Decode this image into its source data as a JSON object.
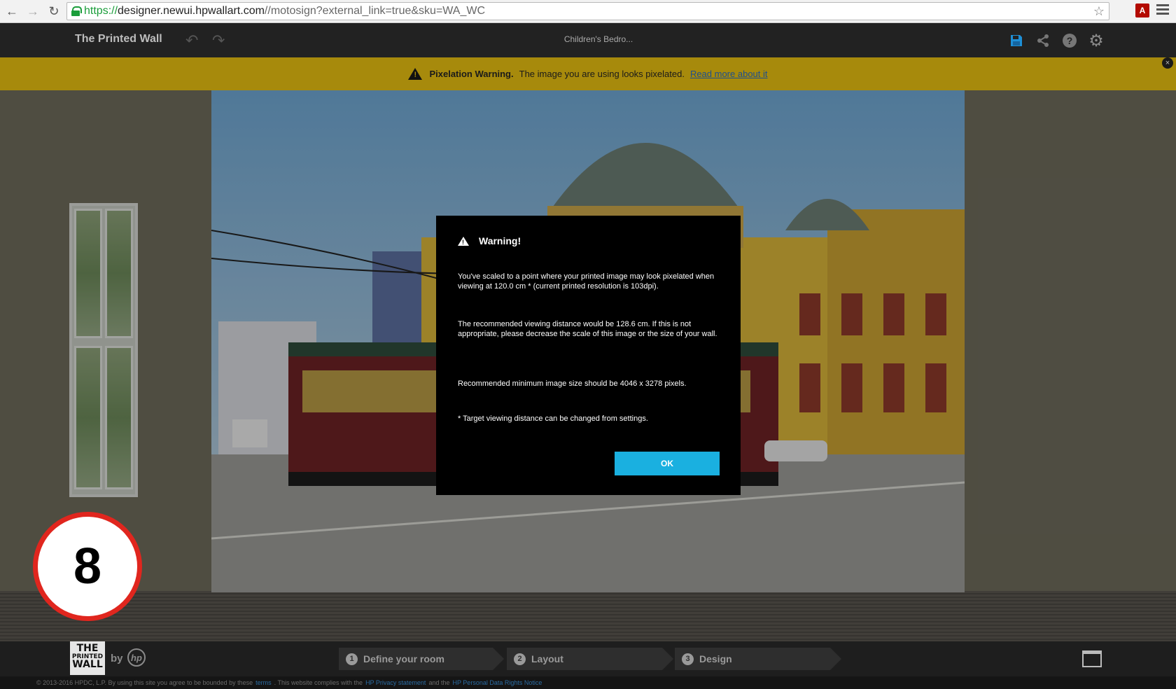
{
  "browser": {
    "url_scheme": "https://",
    "url_host": "designer.newui.hpwallart.com",
    "url_path": "//motosign?external_link=true&sku=WA_WC",
    "pdf_label": "A"
  },
  "app": {
    "brand": "The Printed Wall",
    "document_title": "Children's Bedro..."
  },
  "pixelation_bar": {
    "title": "Pixelation Warning.",
    "message": "The image you are using looks pixelated.",
    "link": "Read more about it",
    "close": "×"
  },
  "modal": {
    "title": "Warning!",
    "p1": "You've scaled to a point where your printed image may look pixelated when viewing at 120.0 cm * (current printed resolution is 103dpi).",
    "p2": "The recommended viewing distance would be 128.6 cm. If this is not appropriate, please decrease the scale of this image or the size of your wall.",
    "p3": "Recommended minimum image size should be 4046 x 3278 pixels.",
    "p4": "* Target viewing distance can be changed from settings.",
    "ok": "OK"
  },
  "badge": {
    "number": "8"
  },
  "footer": {
    "logo_line1": "THE",
    "logo_line2": "PRINTED",
    "logo_line3": "WALL",
    "by": "by",
    "hp": "hp",
    "steps": [
      {
        "num": "1",
        "label": "Define your room"
      },
      {
        "num": "2",
        "label": "Layout"
      },
      {
        "num": "3",
        "label": "Design"
      }
    ]
  },
  "legal": {
    "text1": "© 2013-2016 HPDC, L.P.  By using this site you agree to be bounded by these",
    "link1": "terms",
    "text2": ". This website complies with the",
    "link2": "HP Privacy statement",
    "text3": "and the",
    "link3": "HP Personal Data Rights Notice"
  },
  "colors": {
    "accent": "#1ab0e0",
    "warning_bar": "#a78a0c",
    "badge_ring": "#e0261e",
    "save_icon": "#1e8fd6"
  }
}
